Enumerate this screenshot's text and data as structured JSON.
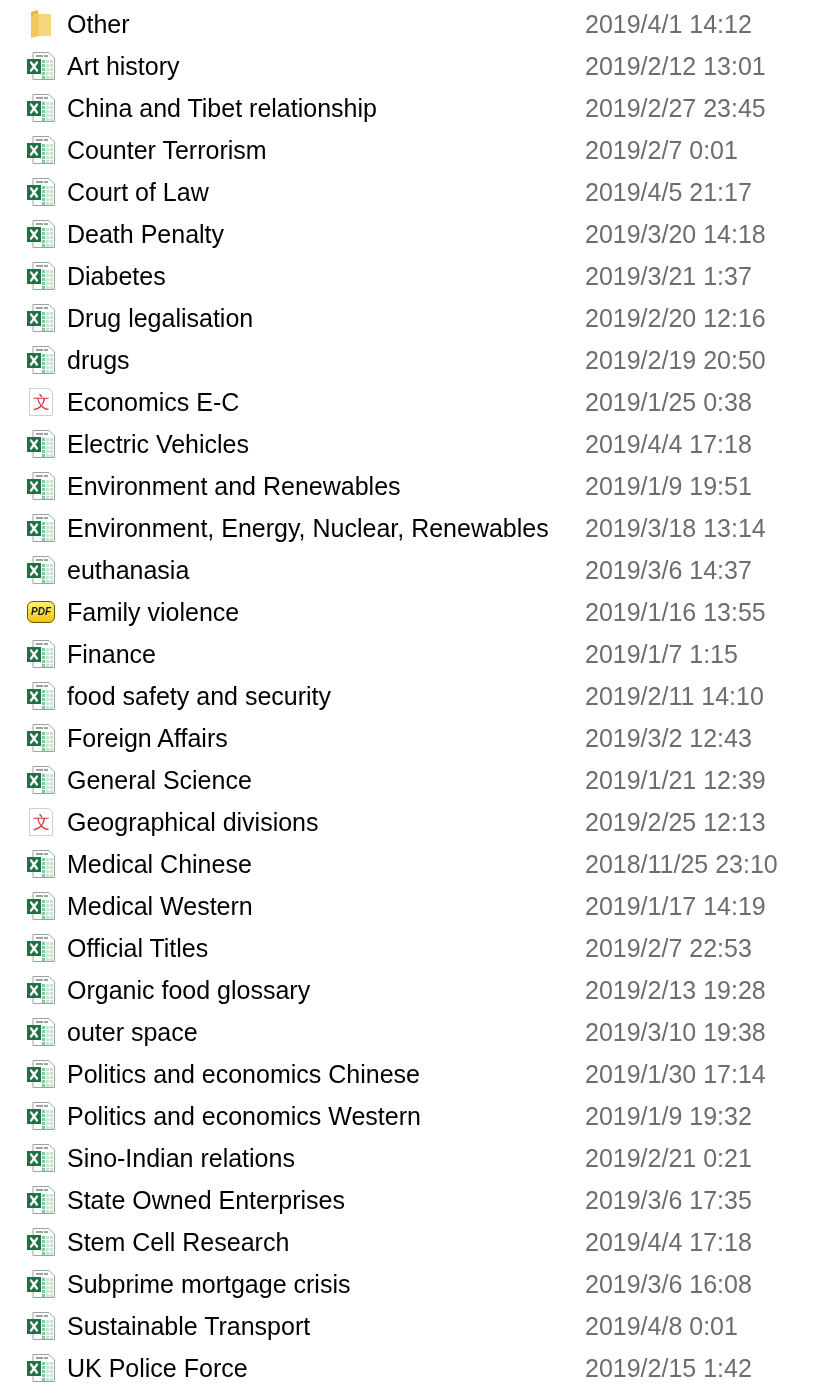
{
  "files": [
    {
      "kind": "folder",
      "name": "Other",
      "modified": "2019/4/1 14:12"
    },
    {
      "kind": "spreadsheet",
      "name": "Art history",
      "modified": "2019/2/12 13:01"
    },
    {
      "kind": "spreadsheet",
      "name": "China and Tibet relationship",
      "modified": "2019/2/27 23:45"
    },
    {
      "kind": "spreadsheet",
      "name": "Counter Terrorism",
      "modified": "2019/2/7 0:01"
    },
    {
      "kind": "spreadsheet",
      "name": "Court of Law",
      "modified": "2019/4/5 21:17"
    },
    {
      "kind": "spreadsheet",
      "name": "Death Penalty",
      "modified": "2019/3/20 14:18"
    },
    {
      "kind": "spreadsheet",
      "name": "Diabetes",
      "modified": "2019/3/21 1:37"
    },
    {
      "kind": "spreadsheet",
      "name": "Drug legalisation",
      "modified": "2019/2/20 12:16"
    },
    {
      "kind": "spreadsheet",
      "name": "drugs",
      "modified": "2019/2/19 20:50"
    },
    {
      "kind": "document",
      "icon_text": "文",
      "name": "Economics E-C",
      "modified": "2019/1/25 0:38"
    },
    {
      "kind": "spreadsheet",
      "name": "Electric Vehicles",
      "modified": "2019/4/4 17:18"
    },
    {
      "kind": "spreadsheet",
      "name": "Environment and Renewables",
      "modified": "2019/1/9 19:51"
    },
    {
      "kind": "spreadsheet",
      "name": "Environment, Energy, Nuclear, Renewables",
      "modified": "2019/3/18 13:14"
    },
    {
      "kind": "spreadsheet",
      "name": "euthanasia",
      "modified": "2019/3/6 14:37"
    },
    {
      "kind": "pdf",
      "icon_text": "PDF",
      "name": "Family violence",
      "modified": "2019/1/16 13:55"
    },
    {
      "kind": "spreadsheet",
      "name": "Finance",
      "modified": "2019/1/7 1:15"
    },
    {
      "kind": "spreadsheet",
      "name": "food safety and security",
      "modified": "2019/2/11 14:10"
    },
    {
      "kind": "spreadsheet",
      "name": "Foreign Affairs",
      "modified": "2019/3/2 12:43"
    },
    {
      "kind": "spreadsheet",
      "name": "General Science",
      "modified": "2019/1/21 12:39"
    },
    {
      "kind": "document",
      "icon_text": "文",
      "name": "Geographical divisions",
      "modified": "2019/2/25 12:13"
    },
    {
      "kind": "spreadsheet",
      "name": "Medical Chinese",
      "modified": "2018/11/25 23:10"
    },
    {
      "kind": "spreadsheet",
      "name": "Medical Western",
      "modified": "2019/1/17 14:19"
    },
    {
      "kind": "spreadsheet",
      "name": "Official Titles",
      "modified": "2019/2/7 22:53"
    },
    {
      "kind": "spreadsheet",
      "name": "Organic food glossary",
      "modified": "2019/2/13 19:28"
    },
    {
      "kind": "spreadsheet",
      "name": "outer space",
      "modified": "2019/3/10 19:38"
    },
    {
      "kind": "spreadsheet",
      "name": "Politics and economics Chinese",
      "modified": "2019/1/30 17:14"
    },
    {
      "kind": "spreadsheet",
      "name": "Politics and economics Western",
      "modified": "2019/1/9 19:32"
    },
    {
      "kind": "spreadsheet",
      "name": "Sino-Indian relations",
      "modified": "2019/2/21 0:21"
    },
    {
      "kind": "spreadsheet",
      "name": "State Owned Enterprises",
      "modified": "2019/3/6 17:35"
    },
    {
      "kind": "spreadsheet",
      "name": "Stem Cell Research",
      "modified": "2019/4/4 17:18"
    },
    {
      "kind": "spreadsheet",
      "name": "Subprime mortgage crisis",
      "modified": "2019/3/6 16:08"
    },
    {
      "kind": "spreadsheet",
      "name": "Sustainable Transport",
      "modified": "2019/4/8 0:01"
    },
    {
      "kind": "spreadsheet",
      "name": "UK Police Force",
      "modified": "2019/2/15 1:42"
    }
  ]
}
